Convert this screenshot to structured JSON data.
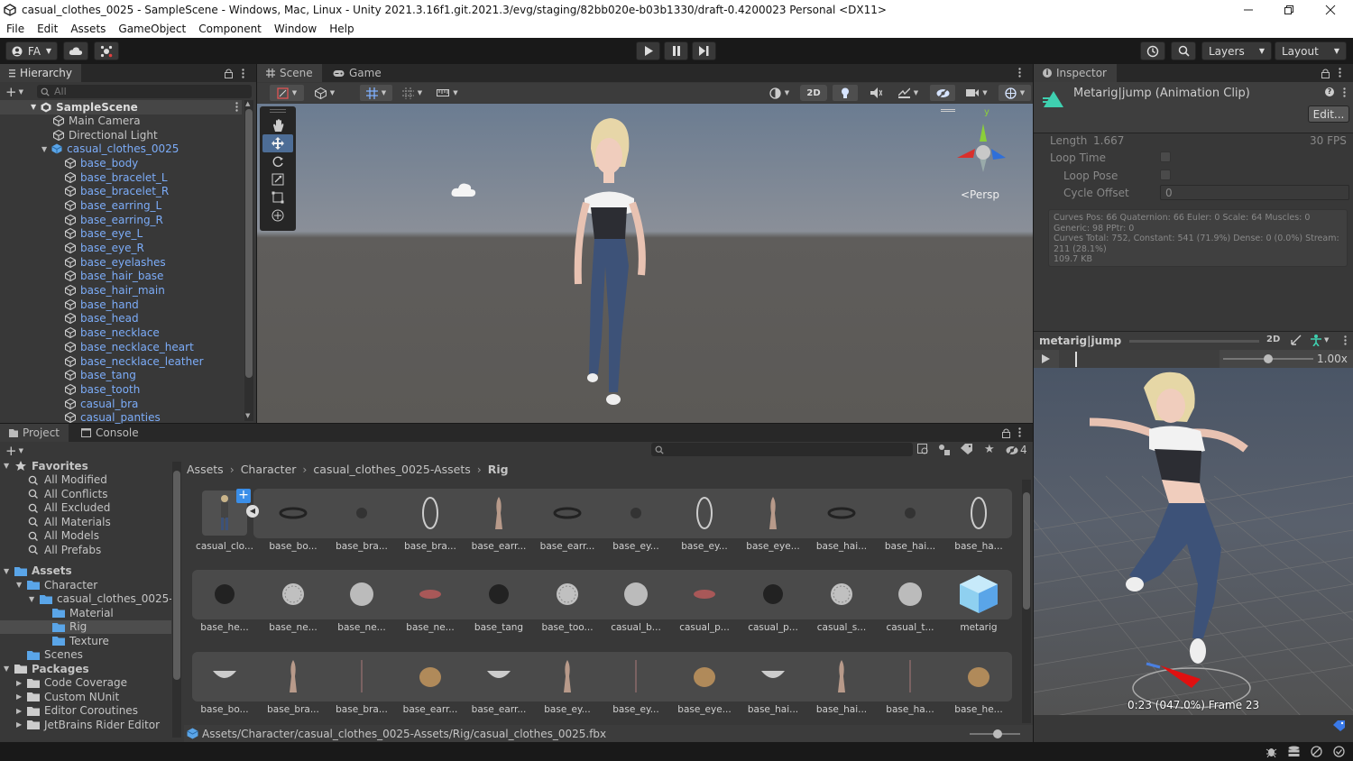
{
  "window": {
    "title": "casual_clothes_0025 - SampleScene - Windows, Mac, Linux - Unity 2021.3.16f1.git.2021.3/evg/staging/82bb020e-b03b1330/draft-0.4200023 Personal <DX11>"
  },
  "menu": [
    "File",
    "Edit",
    "Assets",
    "GameObject",
    "Component",
    "Window",
    "Help"
  ],
  "toolbar": {
    "account": "FA",
    "layers": "Layers",
    "layout": "Layout"
  },
  "hierarchy": {
    "tab": "Hierarchy",
    "search_placeholder": "All",
    "scene": "SampleScene",
    "root_items": [
      "Main Camera",
      "Directional Light"
    ],
    "prefab": "casual_clothes_0025",
    "children": [
      "base_body",
      "base_bracelet_L",
      "base_bracelet_R",
      "base_earring_L",
      "base_earring_R",
      "base_eye_L",
      "base_eye_R",
      "base_eyelashes",
      "base_hair_base",
      "base_hair_main",
      "base_hand",
      "base_head",
      "base_necklace",
      "base_necklace_heart",
      "base_necklace_leather",
      "base_tang",
      "base_tooth",
      "casual_bra",
      "casual_panties"
    ]
  },
  "scene_view": {
    "tabs": [
      "Scene",
      "Game"
    ],
    "mode_2d": "2D",
    "persp_label": "<Persp",
    "gizmo_y": "y"
  },
  "inspector": {
    "tab": "Inspector",
    "title": "Metarig|jump (Animation Clip)",
    "edit_button": "Edit...",
    "length_label": "Length",
    "length_value": "1.667",
    "fps": "30 FPS",
    "loop_time": "Loop Time",
    "loop_pose": "Loop Pose",
    "cycle_offset_label": "Cycle Offset",
    "cycle_offset_value": "0",
    "curves_info": "Curves Pos: 66 Quaternion: 66 Euler: 0 Scale: 64 Muscles: 0 Generic: 98 PPtr: 0\nCurves Total: 752, Constant: 541 (71.9%) Dense: 0 (0.0%) Stream: 211 (28.1%)\n109.7 KB",
    "preview_name": "metarig|jump",
    "preview_2d": "2D",
    "speed": "1.00x",
    "speed_fraction": 0.5,
    "time_fraction": 0.1,
    "frame_label": "0:23 (047.0%) Frame 23"
  },
  "project": {
    "tabs": [
      "Project",
      "Console"
    ],
    "hidden_count": "4",
    "favorites_label": "Favorites",
    "favorites": [
      "All Modified",
      "All Conflicts",
      "All Excluded",
      "All Materials",
      "All Models",
      "All Prefabs"
    ],
    "assets_label": "Assets",
    "tree": [
      {
        "label": "Character",
        "depth": 1
      },
      {
        "label": "casual_clothes_0025-/",
        "depth": 2
      },
      {
        "label": "Material",
        "depth": 3
      },
      {
        "label": "Rig",
        "depth": 3,
        "selected": true
      },
      {
        "label": "Texture",
        "depth": 3
      },
      {
        "label": "Scenes",
        "depth": 1
      }
    ],
    "packages_label": "Packages",
    "packages": [
      "Code Coverage",
      "Custom NUnit",
      "Editor Coroutines",
      "JetBrains Rider Editor"
    ],
    "breadcrumb": [
      "Assets",
      "Character",
      "casual_clothes_0025-Assets",
      "Rig"
    ],
    "row1": [
      "casual_clo...",
      "base_bo...",
      "base_bra...",
      "base_bra...",
      "base_earr...",
      "base_earr...",
      "base_ey...",
      "base_ey...",
      "base_eye...",
      "base_hai...",
      "base_hai...",
      "base_ha..."
    ],
    "row2": [
      "base_he...",
      "base_ne...",
      "base_ne...",
      "base_ne...",
      "base_tang",
      "base_too...",
      "casual_b...",
      "casual_p...",
      "casual_p...",
      "casual_s...",
      "casual_t...",
      "metarig"
    ],
    "row3": [
      "base_bo...",
      "base_bra...",
      "base_bra...",
      "base_earr...",
      "base_earr...",
      "base_ey...",
      "base_ey...",
      "base_eye...",
      "base_hai...",
      "base_hai...",
      "base_ha...",
      "base_he..."
    ],
    "status_path": "Assets/Character/casual_clothes_0025-Assets/Rig/casual_clothes_0025.fbx"
  }
}
